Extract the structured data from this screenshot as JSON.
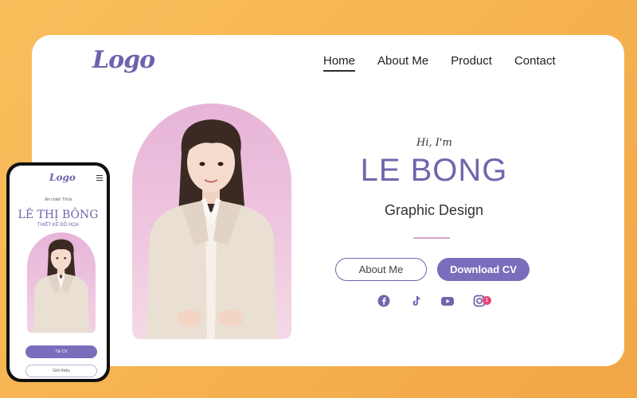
{
  "desktop": {
    "logo": "Logo",
    "nav": [
      "Home",
      "About Me",
      "Product",
      "Contact"
    ],
    "active_nav": "Home",
    "greeting": "Hi, I'm",
    "name": "LE BONG",
    "role": "Graphic Design",
    "buttons": {
      "about": "About Me",
      "download": "Download CV"
    },
    "socials": [
      "facebook-icon",
      "tiktok-icon",
      "youtube-icon",
      "instagram-icon"
    ],
    "notification_count": "1"
  },
  "mobile": {
    "logo": "Logo",
    "greeting": "Xin chào! Tôi là",
    "name": "LÊ THỊ BÔNG",
    "subtitle": "THIẾT KẾ ĐỒ HỌA",
    "button_primary": "Tải CV",
    "button_secondary": "Giới thiệu"
  },
  "colors": {
    "accent": "#6f66ad",
    "button": "#7a6dbb",
    "background": "#f6b250",
    "arch_pink": "#e7b4d8",
    "badge": "#e8457a"
  }
}
